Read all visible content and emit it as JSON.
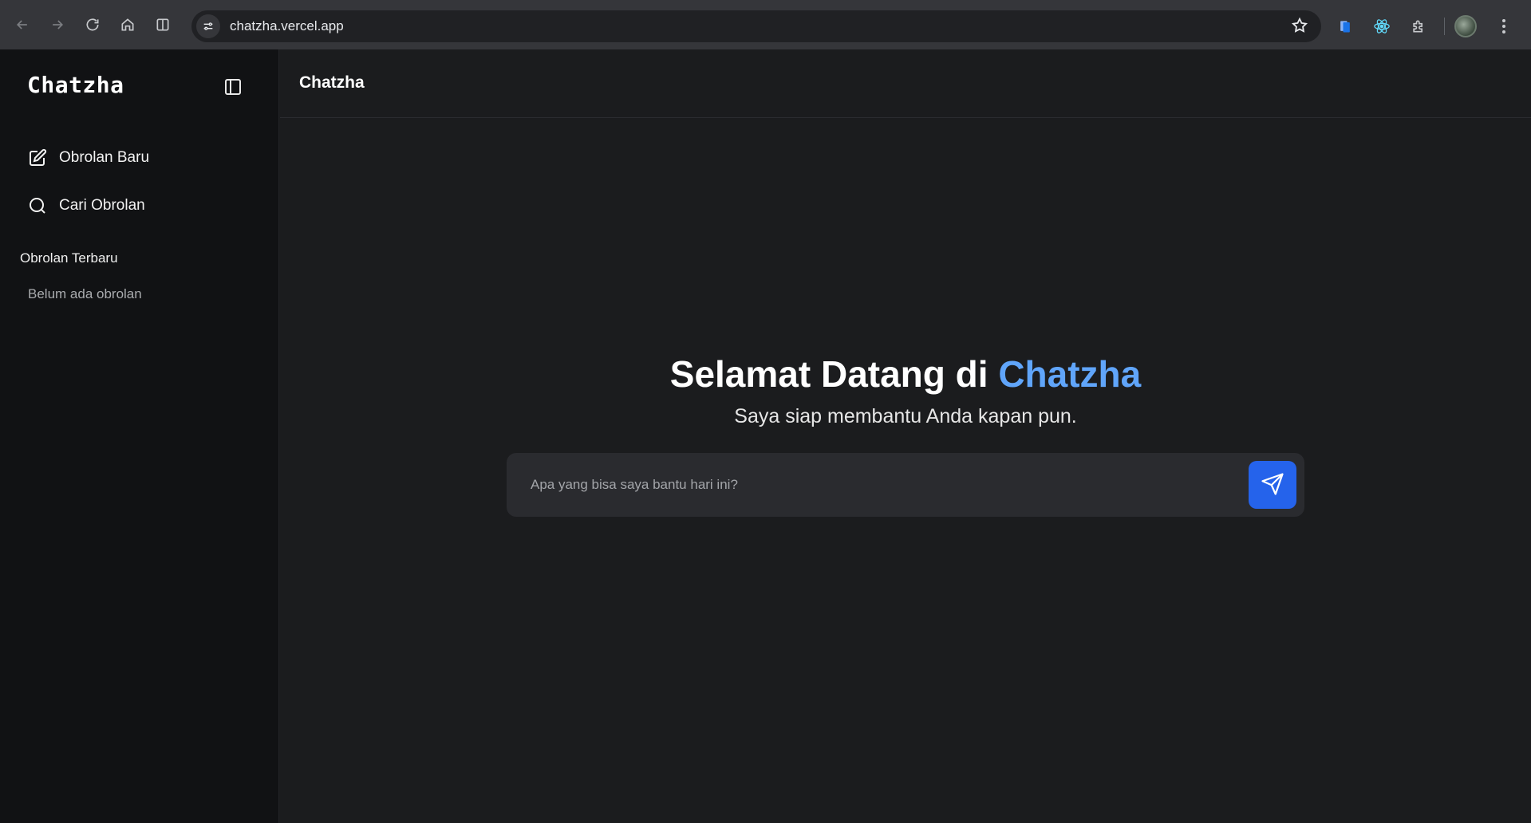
{
  "browser": {
    "url": "chatzha.vercel.app"
  },
  "sidebar": {
    "brand": "Chatzha",
    "items": [
      {
        "label": "Obrolan Baru",
        "icon": "edit-icon"
      },
      {
        "label": "Cari Obrolan",
        "icon": "search-icon"
      }
    ],
    "recent_title": "Obrolan Terbaru",
    "recent_empty": "Belum ada obrolan"
  },
  "header": {
    "title": "Chatzha"
  },
  "hero": {
    "title_prefix": "Selamat Datang di ",
    "title_accent": "Chatzha",
    "subtitle": "Saya siap membantu Anda kapan pun."
  },
  "composer": {
    "placeholder": "Apa yang bisa saya bantu hari ini?",
    "value": ""
  },
  "colors": {
    "accent": "#60a5fa",
    "send_button": "#2563eb",
    "sidebar_bg": "#111214",
    "main_bg": "#1b1c1e"
  }
}
